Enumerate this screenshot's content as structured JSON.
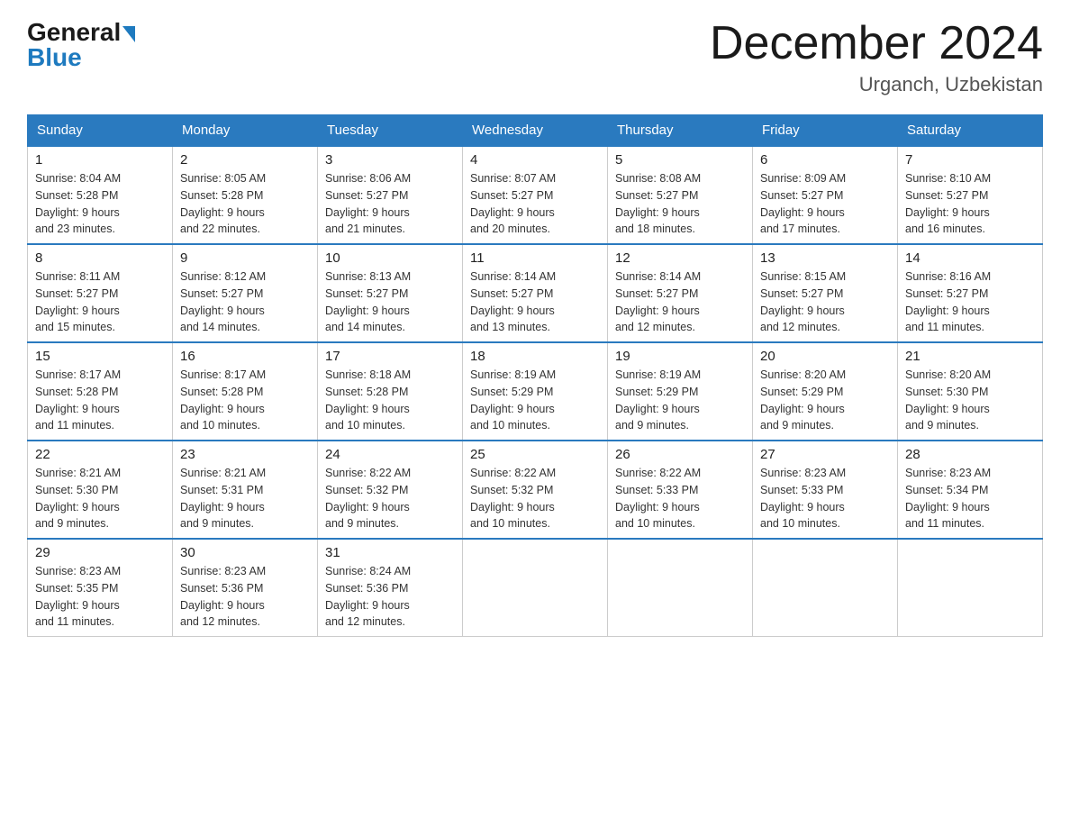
{
  "header": {
    "logo_general": "General",
    "logo_blue": "Blue",
    "title": "December 2024",
    "location": "Urganch, Uzbekistan"
  },
  "days_of_week": [
    "Sunday",
    "Monday",
    "Tuesday",
    "Wednesday",
    "Thursday",
    "Friday",
    "Saturday"
  ],
  "weeks": [
    [
      {
        "day": "1",
        "sunrise": "8:04 AM",
        "sunset": "5:28 PM",
        "daylight": "9 hours and 23 minutes."
      },
      {
        "day": "2",
        "sunrise": "8:05 AM",
        "sunset": "5:28 PM",
        "daylight": "9 hours and 22 minutes."
      },
      {
        "day": "3",
        "sunrise": "8:06 AM",
        "sunset": "5:27 PM",
        "daylight": "9 hours and 21 minutes."
      },
      {
        "day": "4",
        "sunrise": "8:07 AM",
        "sunset": "5:27 PM",
        "daylight": "9 hours and 20 minutes."
      },
      {
        "day": "5",
        "sunrise": "8:08 AM",
        "sunset": "5:27 PM",
        "daylight": "9 hours and 18 minutes."
      },
      {
        "day": "6",
        "sunrise": "8:09 AM",
        "sunset": "5:27 PM",
        "daylight": "9 hours and 17 minutes."
      },
      {
        "day": "7",
        "sunrise": "8:10 AM",
        "sunset": "5:27 PM",
        "daylight": "9 hours and 16 minutes."
      }
    ],
    [
      {
        "day": "8",
        "sunrise": "8:11 AM",
        "sunset": "5:27 PM",
        "daylight": "9 hours and 15 minutes."
      },
      {
        "day": "9",
        "sunrise": "8:12 AM",
        "sunset": "5:27 PM",
        "daylight": "9 hours and 14 minutes."
      },
      {
        "day": "10",
        "sunrise": "8:13 AM",
        "sunset": "5:27 PM",
        "daylight": "9 hours and 14 minutes."
      },
      {
        "day": "11",
        "sunrise": "8:14 AM",
        "sunset": "5:27 PM",
        "daylight": "9 hours and 13 minutes."
      },
      {
        "day": "12",
        "sunrise": "8:14 AM",
        "sunset": "5:27 PM",
        "daylight": "9 hours and 12 minutes."
      },
      {
        "day": "13",
        "sunrise": "8:15 AM",
        "sunset": "5:27 PM",
        "daylight": "9 hours and 12 minutes."
      },
      {
        "day": "14",
        "sunrise": "8:16 AM",
        "sunset": "5:27 PM",
        "daylight": "9 hours and 11 minutes."
      }
    ],
    [
      {
        "day": "15",
        "sunrise": "8:17 AM",
        "sunset": "5:28 PM",
        "daylight": "9 hours and 11 minutes."
      },
      {
        "day": "16",
        "sunrise": "8:17 AM",
        "sunset": "5:28 PM",
        "daylight": "9 hours and 10 minutes."
      },
      {
        "day": "17",
        "sunrise": "8:18 AM",
        "sunset": "5:28 PM",
        "daylight": "9 hours and 10 minutes."
      },
      {
        "day": "18",
        "sunrise": "8:19 AM",
        "sunset": "5:29 PM",
        "daylight": "9 hours and 10 minutes."
      },
      {
        "day": "19",
        "sunrise": "8:19 AM",
        "sunset": "5:29 PM",
        "daylight": "9 hours and 9 minutes."
      },
      {
        "day": "20",
        "sunrise": "8:20 AM",
        "sunset": "5:29 PM",
        "daylight": "9 hours and 9 minutes."
      },
      {
        "day": "21",
        "sunrise": "8:20 AM",
        "sunset": "5:30 PM",
        "daylight": "9 hours and 9 minutes."
      }
    ],
    [
      {
        "day": "22",
        "sunrise": "8:21 AM",
        "sunset": "5:30 PM",
        "daylight": "9 hours and 9 minutes."
      },
      {
        "day": "23",
        "sunrise": "8:21 AM",
        "sunset": "5:31 PM",
        "daylight": "9 hours and 9 minutes."
      },
      {
        "day": "24",
        "sunrise": "8:22 AM",
        "sunset": "5:32 PM",
        "daylight": "9 hours and 9 minutes."
      },
      {
        "day": "25",
        "sunrise": "8:22 AM",
        "sunset": "5:32 PM",
        "daylight": "9 hours and 10 minutes."
      },
      {
        "day": "26",
        "sunrise": "8:22 AM",
        "sunset": "5:33 PM",
        "daylight": "9 hours and 10 minutes."
      },
      {
        "day": "27",
        "sunrise": "8:23 AM",
        "sunset": "5:33 PM",
        "daylight": "9 hours and 10 minutes."
      },
      {
        "day": "28",
        "sunrise": "8:23 AM",
        "sunset": "5:34 PM",
        "daylight": "9 hours and 11 minutes."
      }
    ],
    [
      {
        "day": "29",
        "sunrise": "8:23 AM",
        "sunset": "5:35 PM",
        "daylight": "9 hours and 11 minutes."
      },
      {
        "day": "30",
        "sunrise": "8:23 AM",
        "sunset": "5:36 PM",
        "daylight": "9 hours and 12 minutes."
      },
      {
        "day": "31",
        "sunrise": "8:24 AM",
        "sunset": "5:36 PM",
        "daylight": "9 hours and 12 minutes."
      },
      null,
      null,
      null,
      null
    ]
  ],
  "labels": {
    "sunrise": "Sunrise:",
    "sunset": "Sunset:",
    "daylight": "Daylight:"
  }
}
